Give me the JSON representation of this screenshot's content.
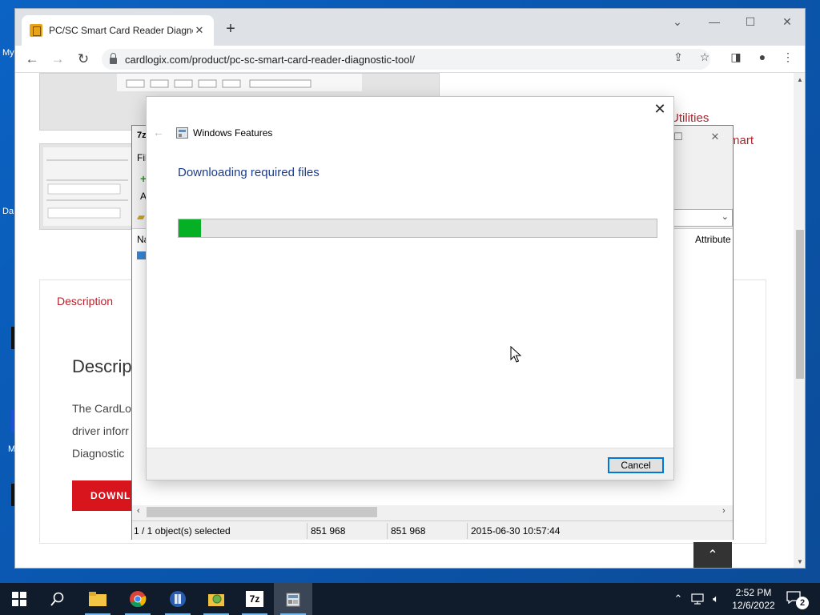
{
  "desktop": {
    "fragments": [
      "My",
      "Da",
      "M"
    ]
  },
  "browser": {
    "tab_title": "PC/SC Smart Card Reader Diagno",
    "tab_close": "✕",
    "new_tab": "+",
    "url": "cardlogix.com/product/pc-sc-smart-card-reader-diagnostic-tool/",
    "window_controls": {
      "dropdown": "⌄",
      "minimize": "—",
      "maximize": "☐",
      "close": "✕"
    }
  },
  "webpage": {
    "utilities_link": "Utilities",
    "smart_link": "mart",
    "description_tab": "Description",
    "description_heading": "Descrip",
    "description_lines": [
      "The CardLo",
      "driver inforr",
      "Diagnostic"
    ],
    "download_button": "DOWNL",
    "back_to_top": "⌃"
  },
  "sevenzip": {
    "menu_fragment": "Fil",
    "toolbar_fragment": "A",
    "column_name": "Na",
    "column_attributes": "Attribute",
    "status": {
      "selection": "1 / 1 object(s) selected",
      "size": "851 968",
      "packed": "851 968",
      "modified": "2015-06-30 10:57:44"
    }
  },
  "dialog": {
    "title": "Windows Features",
    "heading": "Downloading required files",
    "progress": 0.047,
    "progress_color": "#06b025",
    "cancel_label": "Cancel"
  },
  "taskbar": {
    "apps": [
      "start-icon",
      "search-icon",
      "file-explorer-icon",
      "chrome-icon",
      "app-icon",
      "search-folder-icon",
      "7zip-icon",
      "windows-features-icon"
    ],
    "sevenzip_label": "7z",
    "clock_time": "2:52 PM",
    "clock_date": "12/6/2022",
    "notification_count": "2"
  }
}
